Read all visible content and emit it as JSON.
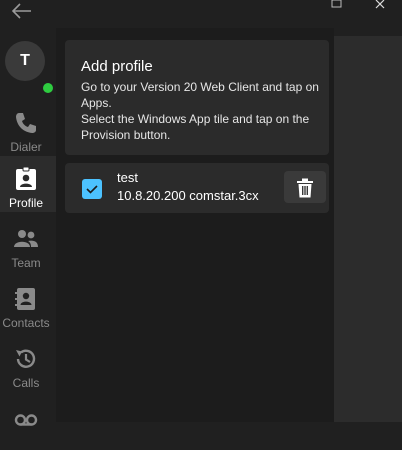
{
  "window": {
    "back_icon": "arrow-left-icon",
    "restore_icon": "restore-icon",
    "close_icon": "close-icon"
  },
  "user": {
    "initial": "T",
    "status_color": "#2ecc40"
  },
  "nav": [
    {
      "label": "Dialer",
      "icon": "phone-icon",
      "active": false
    },
    {
      "label": "Profile",
      "icon": "id-badge-icon",
      "active": true
    },
    {
      "label": "Team",
      "icon": "people-icon",
      "active": false
    },
    {
      "label": "Contacts",
      "icon": "address-book-icon",
      "active": false
    },
    {
      "label": "Calls",
      "icon": "history-icon",
      "active": false
    },
    {
      "label": "",
      "icon": "voicemail-icon",
      "active": false
    }
  ],
  "add_profile": {
    "title": "Add profile",
    "line1": "Go to your Version 20 Web Client and tap on Apps.",
    "line2": "Select the Windows App tile and tap on the Provision button."
  },
  "profiles": [
    {
      "name": "test",
      "address": "10.8.20.200 comstar.3cx",
      "checked": true
    }
  ],
  "colors": {
    "accent": "#4cc2ff",
    "background": "#202020",
    "card": "#2b2b2b"
  }
}
